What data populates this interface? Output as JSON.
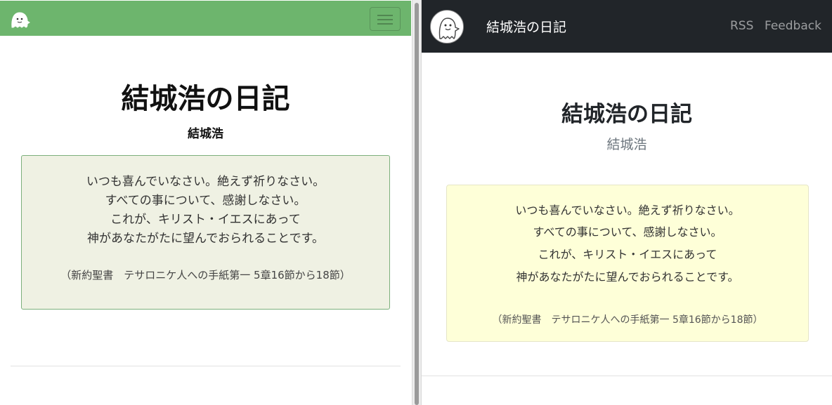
{
  "left": {
    "title": "結城浩の日記",
    "author": "結城浩",
    "quote": {
      "lines": [
        "いつも喜んでいなさい。絶えず祈りなさい。",
        "すべての事について、感謝しなさい。",
        "これが、キリスト・イエスにあって",
        "神があなたがたに望んでおられることです。"
      ],
      "source": "（新約聖書　テサロニケ人への手紙第一 5章16節から18節）"
    },
    "icons": {
      "logo": "ghost-icon",
      "toggler": "hamburger-icon"
    },
    "colors": {
      "navbar": "#6db56d",
      "quote_bg": "#eff1e3",
      "quote_border": "#7cb07c"
    }
  },
  "right": {
    "brand": "結城浩の日記",
    "nav": {
      "rss": "RSS",
      "feedback": "Feedback"
    },
    "title": "結城浩の日記",
    "author": "結城浩",
    "quote": {
      "lines": [
        "いつも喜んでいなさい。絶えず祈りなさい。",
        "すべての事について、感謝しなさい。",
        "これが、キリスト・イエスにあって",
        "神があなたがたに望んでおられることです。"
      ],
      "source": "（新約聖書　テサロニケ人への手紙第一 5章16節から18節）"
    },
    "icons": {
      "logo": "ghost-icon"
    },
    "colors": {
      "navbar": "#212529",
      "quote_bg": "#feffd8",
      "quote_border": "#e5e5c8"
    }
  }
}
